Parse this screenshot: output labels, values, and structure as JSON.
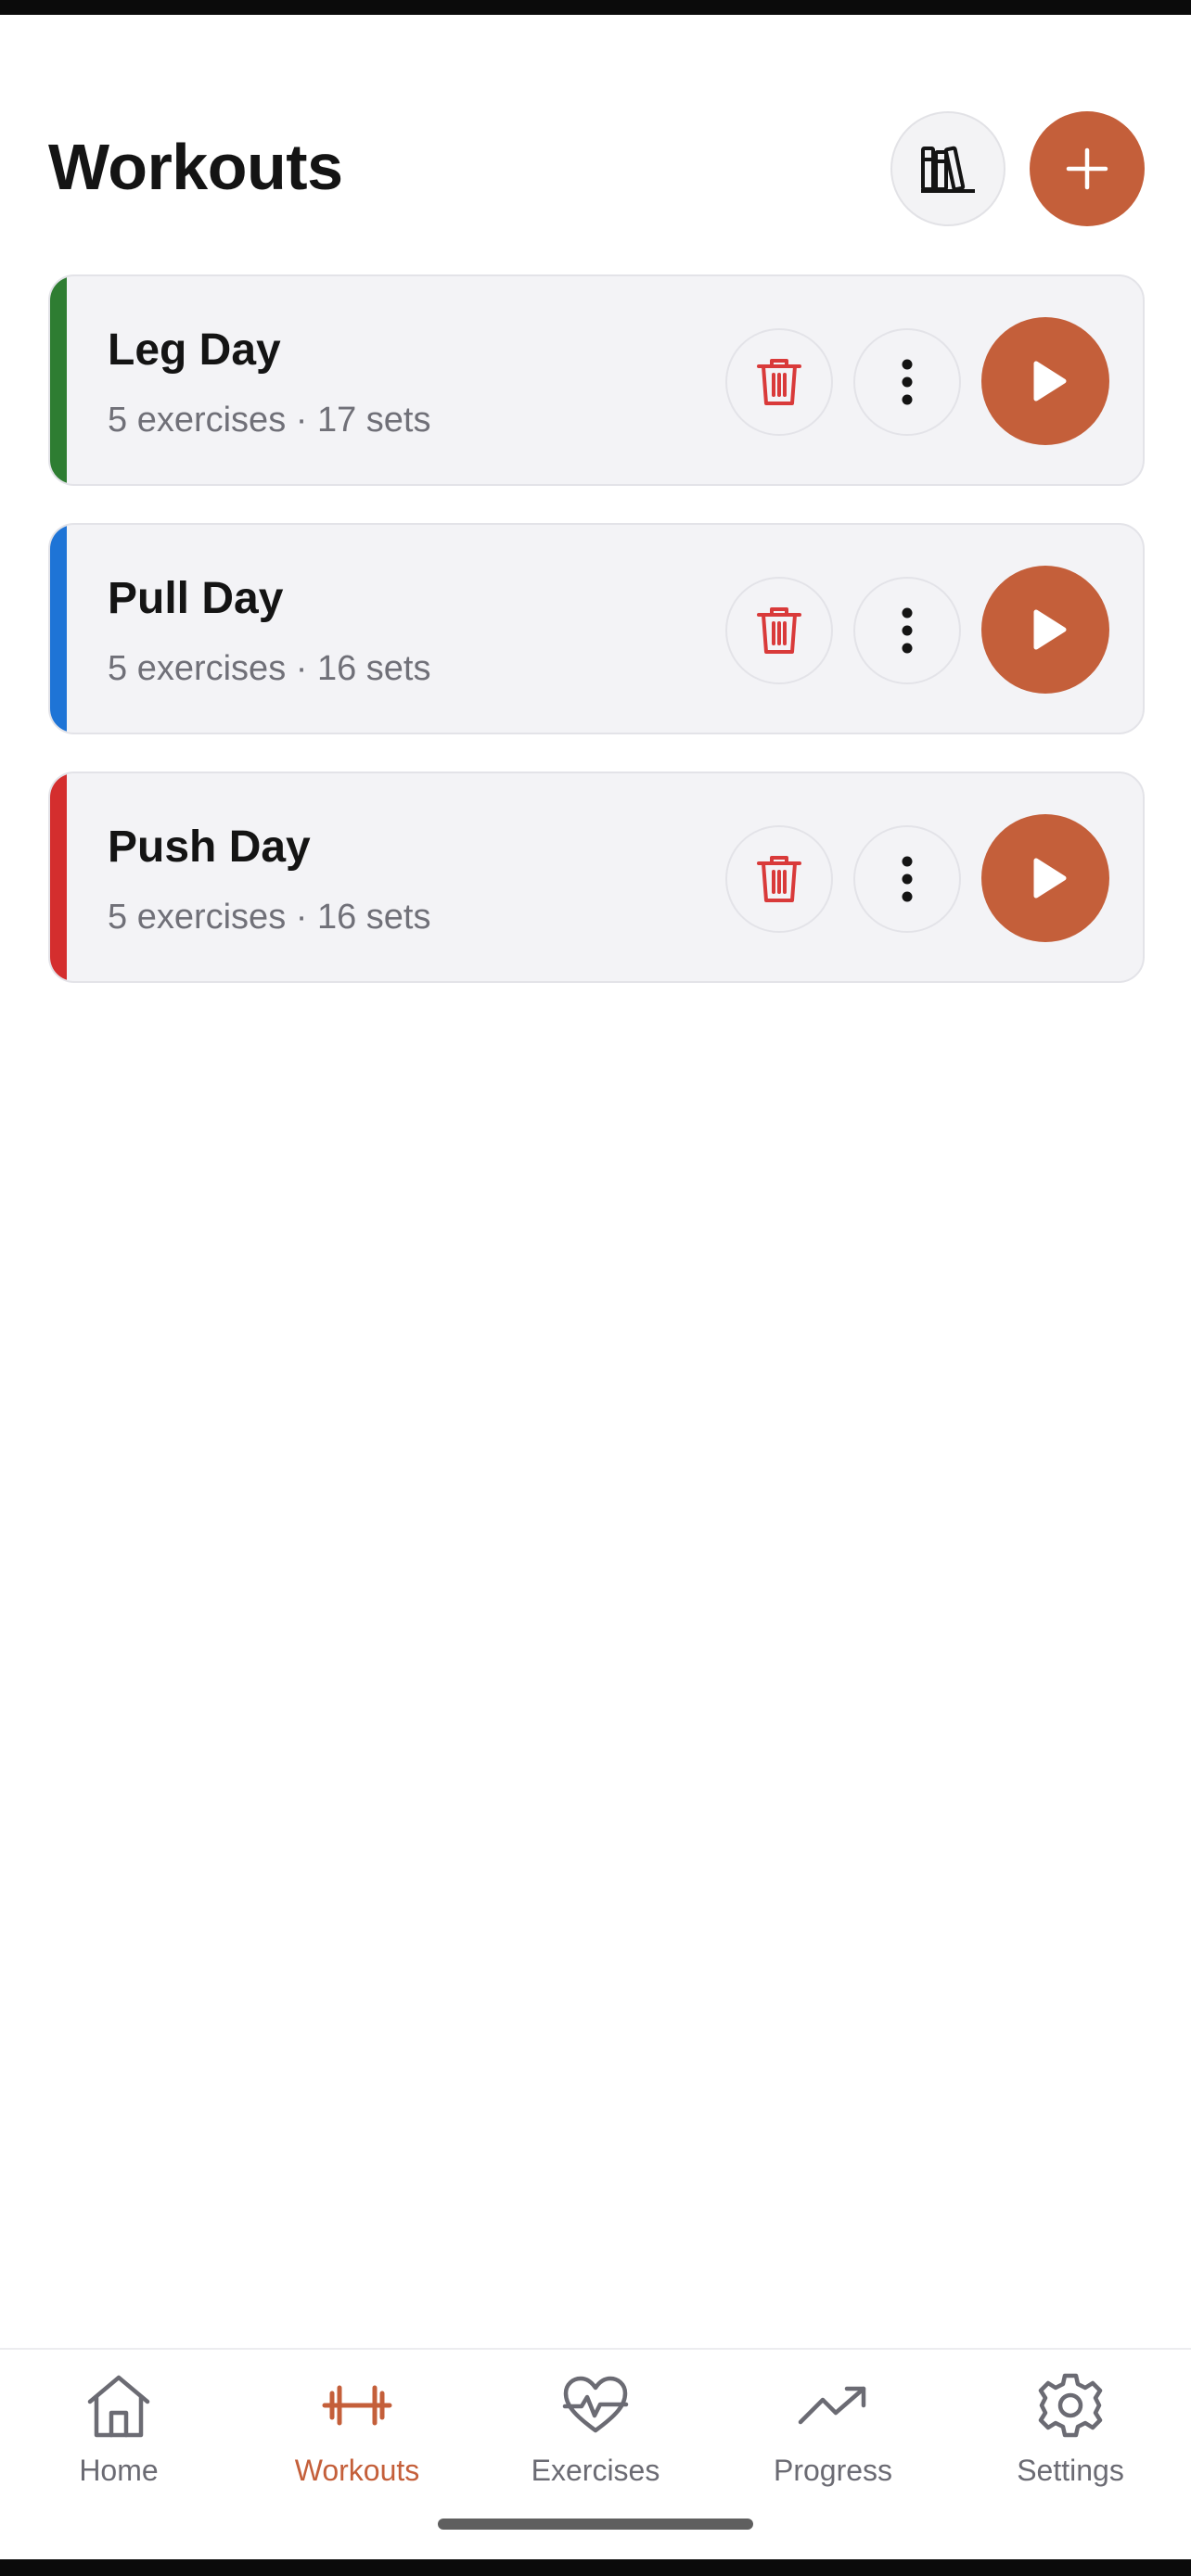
{
  "header": {
    "title": "Workouts",
    "library_icon": "library-icon",
    "add_icon": "plus-icon"
  },
  "workouts": [
    {
      "name": "Leg Day",
      "meta": "5 exercises · 17 sets",
      "accent": "#2e7d32"
    },
    {
      "name": "Pull Day",
      "meta": "5 exercises · 16 sets",
      "accent": "#1e74d6"
    },
    {
      "name": "Push Day",
      "meta": "5 exercises · 16 sets",
      "accent": "#d42e2e"
    }
  ],
  "card_actions": {
    "delete_icon": "trash-icon",
    "more_icon": "more-vertical-icon",
    "start_icon": "play-icon"
  },
  "tabs": [
    {
      "label": "Home",
      "icon": "home-icon",
      "active": false
    },
    {
      "label": "Workouts",
      "icon": "dumbbell-icon",
      "active": true
    },
    {
      "label": "Exercises",
      "icon": "heart-pulse-icon",
      "active": false
    },
    {
      "label": "Progress",
      "icon": "trending-up-icon",
      "active": false
    },
    {
      "label": "Settings",
      "icon": "gear-icon",
      "active": false
    }
  ],
  "colors": {
    "brand": "#c45f3a",
    "delete": "#d93a3a",
    "text": "#141414",
    "muted": "#707078"
  }
}
